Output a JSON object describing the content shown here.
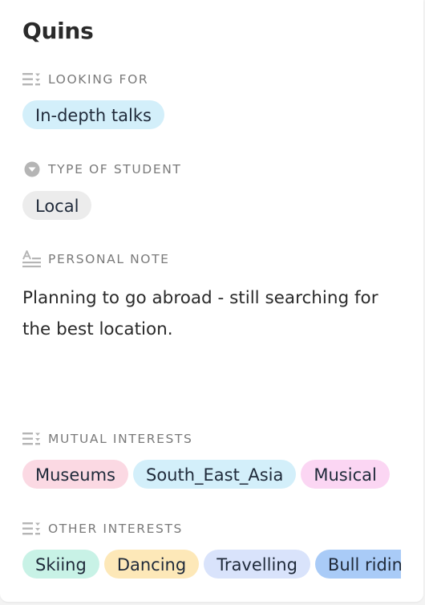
{
  "profile": {
    "name": "Quins"
  },
  "fields": {
    "looking_for": {
      "label": "LOOKING FOR",
      "icon": "list-icon",
      "chips": [
        {
          "label": "In-depth talks",
          "color": "#d3effa"
        }
      ]
    },
    "type_of_student": {
      "label": "TYPE OF STUDENT",
      "icon": "dropdown-circle-icon",
      "chips": [
        {
          "label": "Local",
          "color": "#ececec"
        }
      ]
    },
    "personal_note": {
      "label": "PERSONAL NOTE",
      "icon": "text-icon",
      "value": "Planning to go abroad - still searching for the best location."
    },
    "mutual_interests": {
      "label": "MUTUAL INTERESTS",
      "icon": "list-icon",
      "chips": [
        {
          "label": "Museums",
          "color": "#fbd9e3"
        },
        {
          "label": "South_East_Asia",
          "color": "#d3effa"
        },
        {
          "label": "Musical",
          "color": "#fbd6f3"
        }
      ]
    },
    "other_interests": {
      "label": "OTHER INTERESTS",
      "icon": "list-icon",
      "chips": [
        {
          "label": "Skiing",
          "color": "#c8f2e6"
        },
        {
          "label": "Dancing",
          "color": "#fde8b8"
        },
        {
          "label": "Travelling",
          "color": "#d9e3fb"
        },
        {
          "label": "Bull riding",
          "color": "#a9cbf7"
        }
      ]
    }
  }
}
